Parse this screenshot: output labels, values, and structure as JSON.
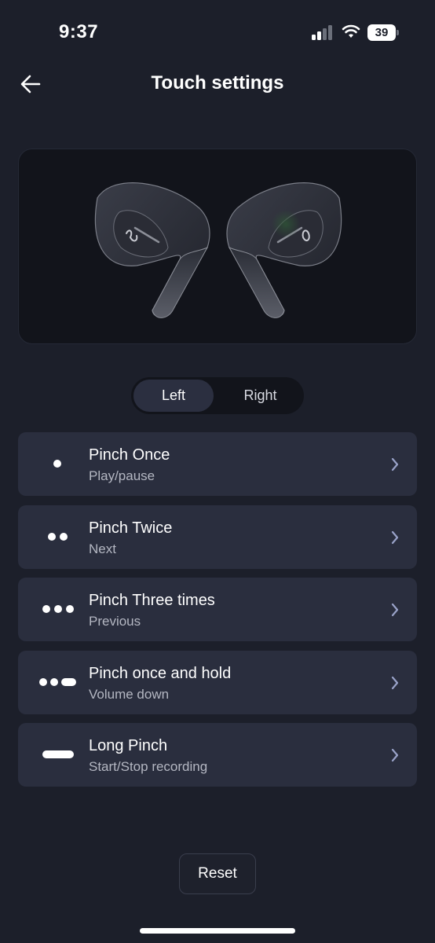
{
  "status_bar": {
    "time": "9:37",
    "battery": "39"
  },
  "header": {
    "title": "Touch settings",
    "back_icon": "arrow-left-icon"
  },
  "side_selector": {
    "options": [
      "Left",
      "Right"
    ],
    "selected": "Left"
  },
  "gestures": [
    {
      "title": "Pinch Once",
      "action": "Play/pause",
      "icon": "one-dot-icon"
    },
    {
      "title": "Pinch Twice",
      "action": "Next",
      "icon": "two-dots-icon"
    },
    {
      "title": "Pinch Three times",
      "action": "Previous",
      "icon": "three-dots-icon"
    },
    {
      "title": "Pinch once and hold",
      "action": "Volume down",
      "icon": "dots-and-bar-icon"
    },
    {
      "title": "Long Pinch",
      "action": "Start/Stop recording",
      "icon": "long-bar-icon"
    }
  ],
  "reset_label": "Reset",
  "colors": {
    "background": "#1c1f2a",
    "card": "#2a2e3e",
    "selected_segment": "#2b2f40",
    "secondary_text": "#b4b7c2",
    "chevron": "#9aa3c9"
  }
}
